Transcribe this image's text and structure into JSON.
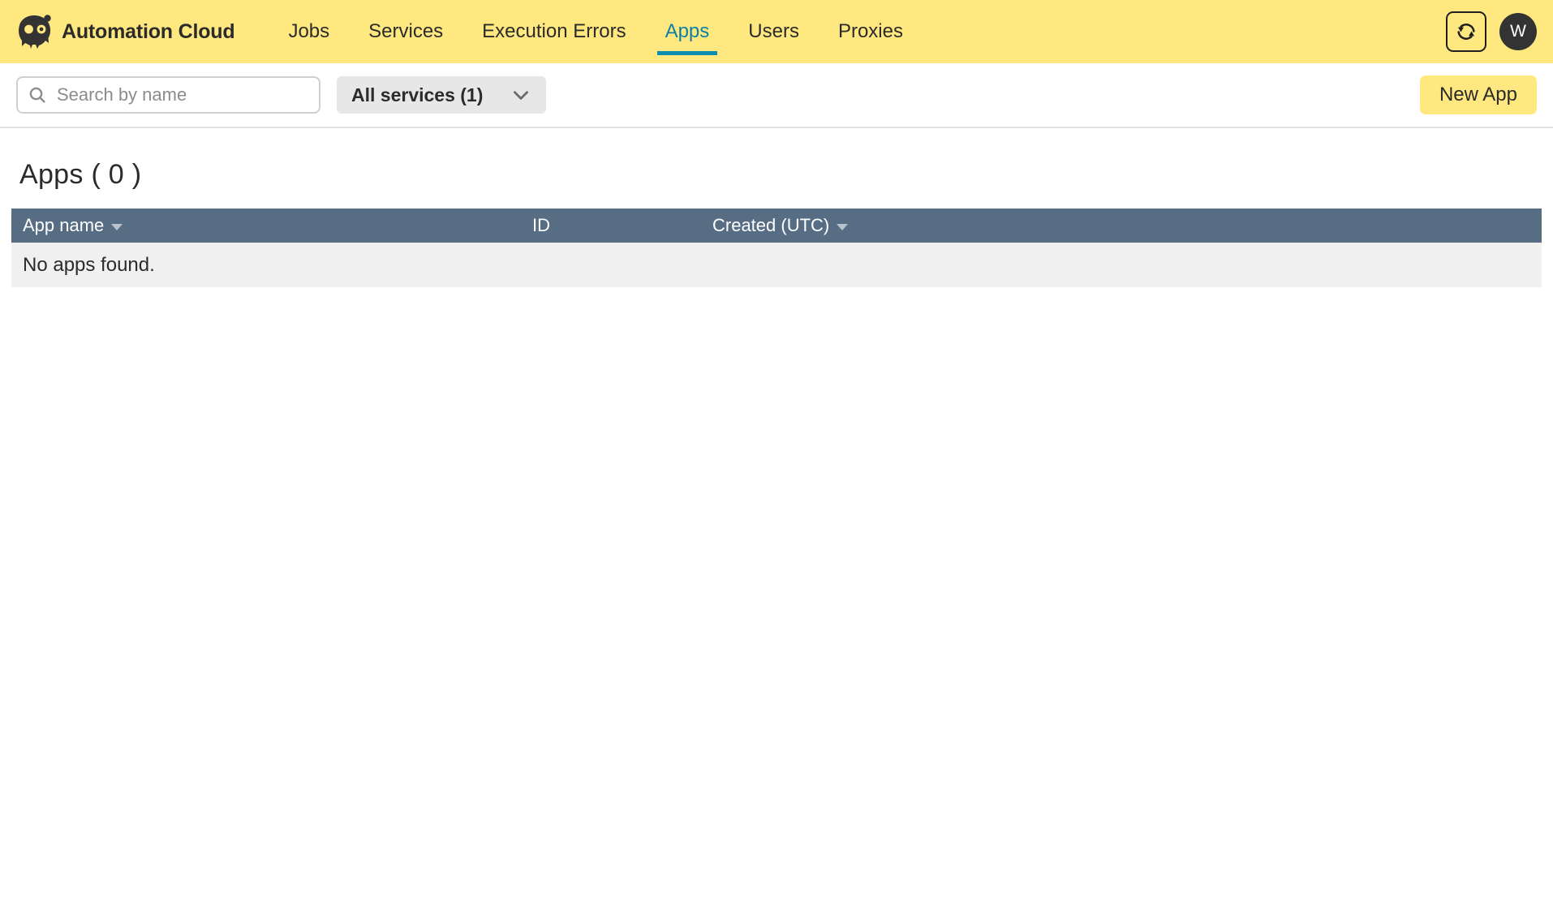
{
  "header": {
    "brand": "Automation Cloud",
    "logo_icon": "owl-logo-icon",
    "nav": [
      {
        "label": "Jobs",
        "active": false
      },
      {
        "label": "Services",
        "active": false
      },
      {
        "label": "Execution Errors",
        "active": false
      },
      {
        "label": "Apps",
        "active": true
      },
      {
        "label": "Users",
        "active": false
      },
      {
        "label": "Proxies",
        "active": false
      }
    ],
    "refresh_icon": "refresh-icon",
    "avatar_initial": "W",
    "background_color": "#ffe880",
    "active_color": "#0e8cb0"
  },
  "toolbar": {
    "search": {
      "icon": "search-icon",
      "placeholder": "Search by name",
      "value": ""
    },
    "service_filter": {
      "label": "All services (1)",
      "icon": "chevron-down-icon"
    },
    "new_app_label": "New App"
  },
  "main": {
    "page_title": "Apps ( 0 )",
    "table": {
      "columns": [
        {
          "label": "App name",
          "sortable": true
        },
        {
          "label": "ID",
          "sortable": false
        },
        {
          "label": "Created (UTC)",
          "sortable": true
        }
      ],
      "rows": [],
      "empty_message": "No apps found.",
      "header_color": "#566d84",
      "empty_row_color": "#f0f0f0"
    }
  }
}
